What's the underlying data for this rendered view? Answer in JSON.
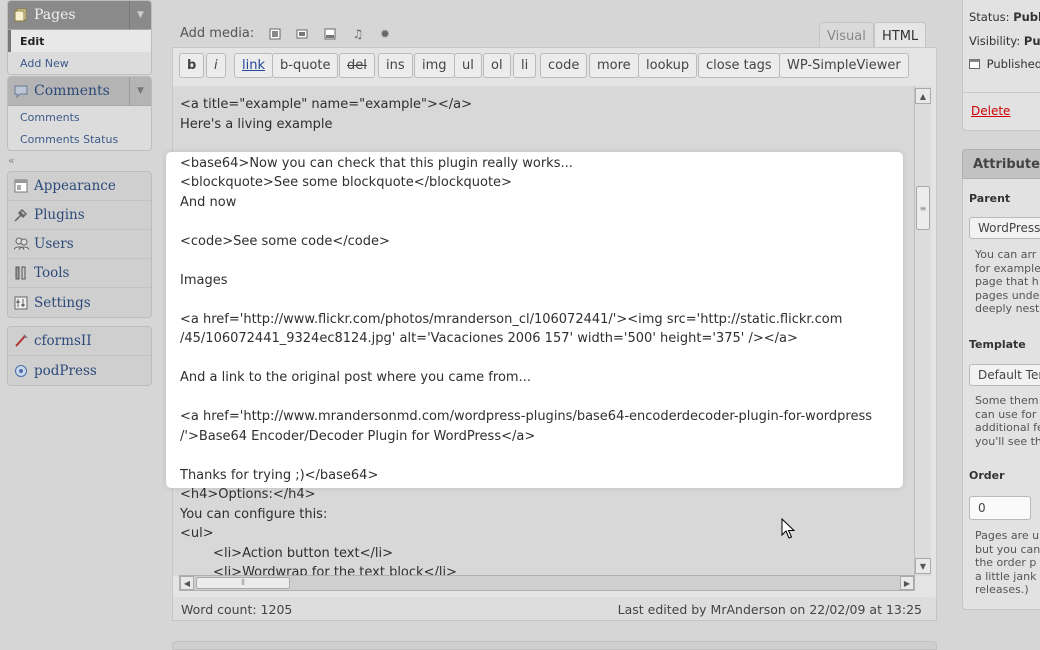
{
  "sidebar_menu": {
    "pages": {
      "label": "Pages",
      "subitems": [
        {
          "label": "Edit"
        },
        {
          "label": "Add New"
        }
      ]
    },
    "comments": {
      "label": "Comments",
      "subitems": [
        {
          "label": "Comments"
        },
        {
          "label": "Comments Status"
        }
      ]
    },
    "collapse_glyph": "«",
    "items": [
      {
        "label": "Appearance",
        "icon": "appearance-icon"
      },
      {
        "label": "Plugins",
        "icon": "plugin-icon"
      },
      {
        "label": "Users",
        "icon": "users-icon"
      },
      {
        "label": "Tools",
        "icon": "tools-icon"
      },
      {
        "label": "Settings",
        "icon": "settings-icon"
      }
    ],
    "plugin_items": [
      {
        "label": "cformsII",
        "icon": "cforms-icon"
      },
      {
        "label": "podPress",
        "icon": "podpress-icon"
      }
    ]
  },
  "editor": {
    "add_media_label": "Add media:",
    "media_icons": [
      "image-icon",
      "video-icon",
      "gallery-icon",
      "audio-icon",
      "media-icon"
    ],
    "tabs": {
      "visual": "Visual",
      "html": "HTML"
    },
    "quicktags": [
      "b",
      "i",
      "link",
      "b-quote",
      "del",
      "ins",
      "img",
      "ul",
      "ol",
      "li",
      "code",
      "more",
      "lookup",
      "close tags",
      "WP-SimpleViewer"
    ],
    "content_lines": [
      "<a title=\"example\" name=\"example\"></a>",
      "Here's a living example",
      "<base64>Now you can check that this plugin really works...",
      "<blockquote>See some blockquote</blockquote>",
      "And now",
      "<code>See some code</code>",
      "Images",
      "<a href='http://www.flickr.com/photos/mranderson_cl/106072441/'><img src='http://static.flickr.com",
      "/45/106072441_9324ec8124.jpg' alt='Vacaciones 2006 157' width='500' height='375' /></a>",
      "And a link to the original post where you came from...",
      "<a href='http://www.mrandersonmd.com/wordpress-plugins/base64-encoderdecoder-plugin-for-wordpress",
      "/'>Base64 Encoder/Decoder Plugin for WordPress</a>",
      "Thanks for trying ;)</base64>",
      "<h4>Options:</h4>",
      "You can configure this:",
      "<ul>",
      "        <li>Action button text</li>",
      "        <li>Wordwrap for the text block</li>"
    ],
    "word_count": "Word count: 1205",
    "last_edited": "Last edited by MrAnderson on 22/02/09 at 13:25"
  },
  "right_panel": {
    "status": {
      "label": "Status:",
      "value": "Publ"
    },
    "visibility": {
      "label": "Visibility:",
      "value": "Pu"
    },
    "published": "Published",
    "delete_label": "Delete",
    "attributes_title": "Attributes",
    "parent_label": "Parent",
    "parent_value": "WordPress",
    "parent_help": [
      "You can arr",
      "for example",
      "page that h",
      "pages unde",
      "deeply nest"
    ],
    "template_label": "Template",
    "template_value": "Default Ten",
    "template_help": [
      "Some them",
      "can use for",
      "additional fe",
      "you'll see th"
    ],
    "order_label": "Order",
    "order_value": "0",
    "order_help": [
      "Pages are u",
      "but you can",
      "the order p",
      "a little jank",
      "releases.)"
    ]
  },
  "colors": {
    "link": "#23489a",
    "delete": "#cc0000",
    "highlight_bg": "#ffffff"
  }
}
